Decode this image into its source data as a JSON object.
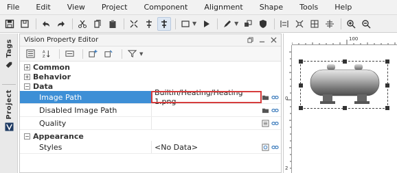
{
  "menu": {
    "items": [
      "File",
      "Edit",
      "View",
      "Project",
      "Component",
      "Alignment",
      "Shape",
      "Tools",
      "Help"
    ]
  },
  "toolbar": {
    "icons": [
      "save-icon",
      "save-all-icon",
      "undo-icon",
      "redo-icon",
      "cut-icon",
      "copy-icon",
      "paste-icon",
      "delete-icon",
      "group-icon",
      "layers-icon",
      "active-layers-icon",
      "rectangle-icon",
      "play-icon",
      "pen-icon",
      "union-icon",
      "shield-icon",
      "align-icon",
      "distribute-icon",
      "grid-icon",
      "snap-icon",
      "zoom-in-icon",
      "zoom-out-icon"
    ]
  },
  "left_tabs": {
    "tags": "Tags",
    "project": "Project"
  },
  "panel": {
    "title": "Vision Property Editor",
    "controls": [
      "restore-icon",
      "minimize-icon",
      "close-icon"
    ]
  },
  "categories": [
    {
      "label": "Common",
      "toggle": "+"
    },
    {
      "label": "Behavior",
      "toggle": "+"
    },
    {
      "label": "Data",
      "toggle": "−"
    }
  ],
  "data_rows": [
    {
      "name": "Image Path",
      "value": "Builtin/Heating/Heating 1.png"
    },
    {
      "name": "Disabled Image Path",
      "value": ""
    },
    {
      "name": "Quality",
      "value": ""
    }
  ],
  "appearance": {
    "label": "Appearance",
    "toggle": "−",
    "rows": [
      {
        "name": "Styles",
        "value": "<No Data>"
      }
    ]
  },
  "canvas": {
    "ruler_top_label": "100",
    "ruler_left_label_1": "0",
    "ruler_left_label_2": "2"
  },
  "colors": {
    "selection": "#3d8fd6",
    "highlight_border": "#d63c3c",
    "link_icon": "#2a6fb5"
  }
}
